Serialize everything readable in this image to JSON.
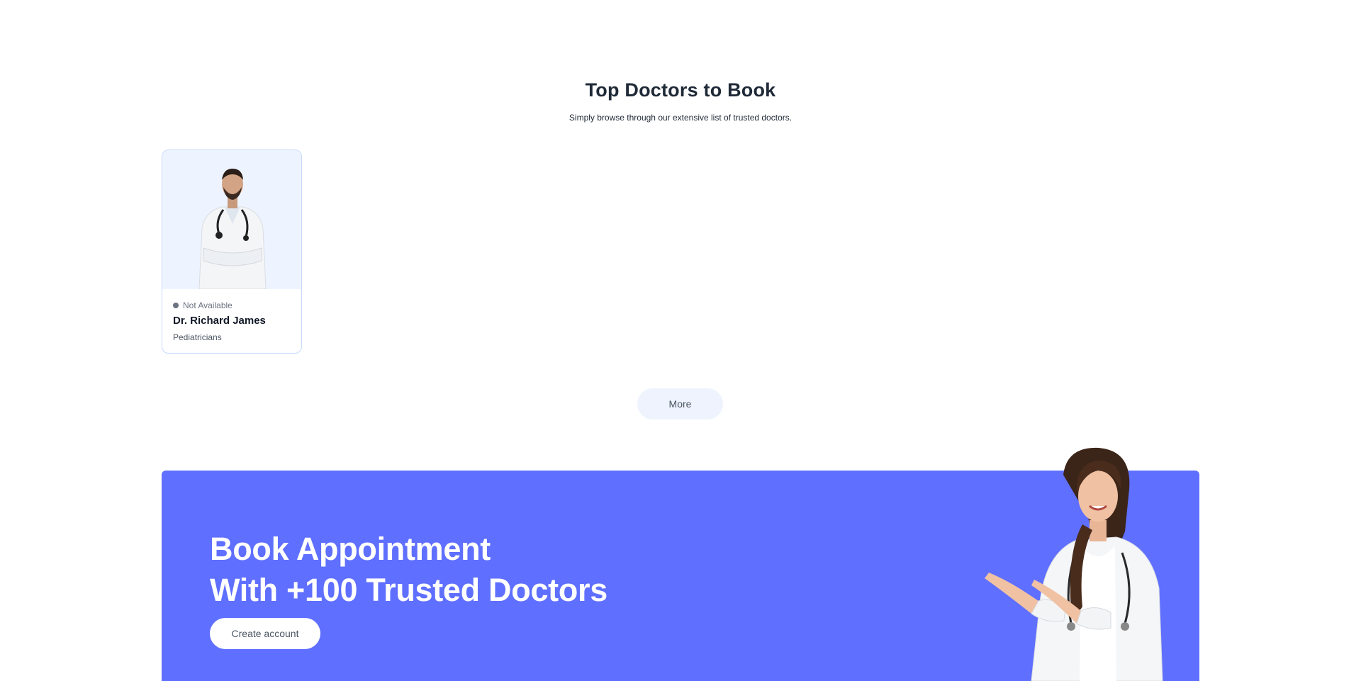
{
  "section": {
    "title": "Top Doctors to Book",
    "subtitle": "Simply browse through our extensive list of trusted doctors."
  },
  "doctors": [
    {
      "availability": "Not Available",
      "name": "Dr. Richard James",
      "specialty": "Pediatricians",
      "status_color": "#6b7280"
    }
  ],
  "more_button": {
    "label": "More"
  },
  "banner": {
    "line1": "Book Appointment",
    "line2": "With +100 Trusted Doctors",
    "cta_label": "Create account",
    "background": "#5f6fff"
  },
  "colors": {
    "accent": "#5f6fff",
    "card_photo_bg": "#eef4ff",
    "card_border": "#c7d9fb"
  }
}
